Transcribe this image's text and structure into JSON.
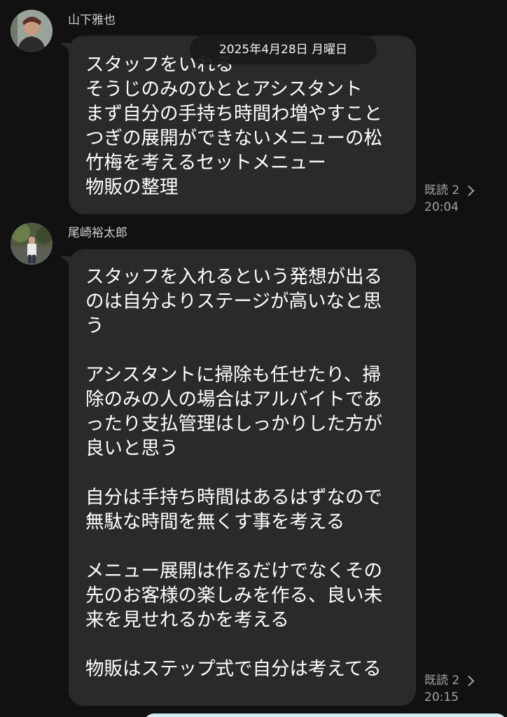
{
  "date_separator": "2025年4月28日 月曜日",
  "messages": [
    {
      "sender": "山下雅也",
      "text": "スタッフをいれる\nそうじのみのひととアシスタント\nまず自分の手持ち時間わ増やすこと\nつぎの展開ができないメニューの松\n竹梅を考えるセットメニュー\n物販の整理",
      "read_label": "既読 2",
      "time": "20:04"
    },
    {
      "sender": "尾崎裕太郎",
      "text": "スタッフを入れるという発想が出る\nのは自分よりステージが高いなと思\nう\n\nアシスタントに掃除も任せたり、掃\n除のみの人の場合はアルバイトであ\nったり支払管理はしっかりした方が\n良いと思う\n\n自分は手持ち時間はあるはずなので\n無駄な時間を無くす事を考える\n\nメニュー展開は作るだけでなくその\n先のお客様の楽しみを作る、良い未\n来を見せれるかを考える\n\n物販はステップ式で自分は考えてる",
      "read_label": "既読 2",
      "time": "20:15"
    }
  ],
  "colors": {
    "background": "#111111",
    "bubble": "#2a2a2a",
    "meta_text": "#a3a3a3",
    "input_edge": "#d3ecf1"
  },
  "icons": {
    "read_chevron": "chevron-right-icon"
  }
}
